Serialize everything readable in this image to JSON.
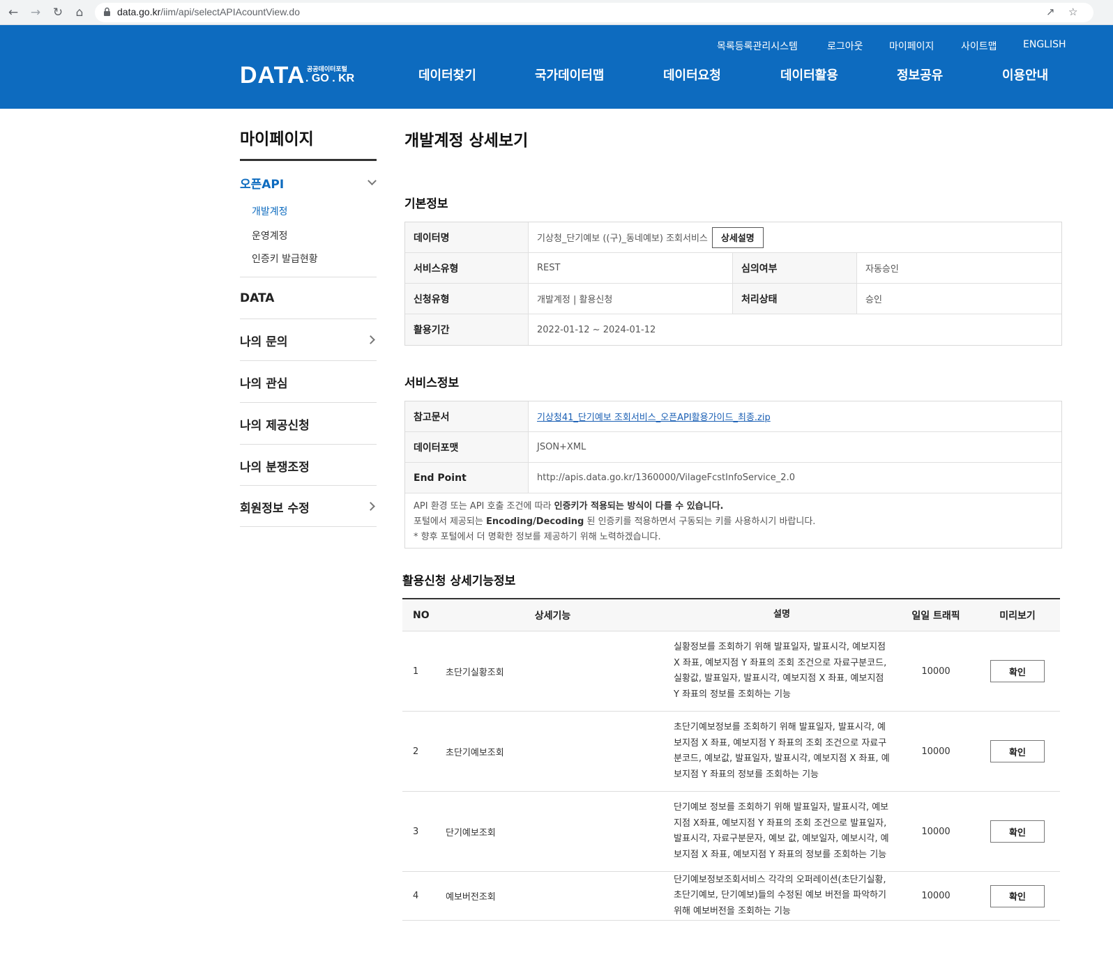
{
  "browser": {
    "url_host": "data.go.kr",
    "url_path": "/iim/api/selectAPIAcountView.do"
  },
  "header": {
    "utility_links": [
      "목록등록관리시스템",
      "로그아웃",
      "마이페이지",
      "사이트맵",
      "ENGLISH"
    ],
    "logo": {
      "main": "DATA",
      "sub": "공공데이터포털",
      "domain": ". GO . KR"
    },
    "gnb": [
      "데이터찾기",
      "국가데이터맵",
      "데이터요청",
      "데이터활용",
      "정보공유",
      "이용안내"
    ]
  },
  "sidebar": {
    "title": "마이페이지",
    "open_menu": "오픈API",
    "sub_items": [
      "개발계정",
      "운영계정",
      "인증키 발급현황"
    ],
    "items": [
      "DATA",
      "나의 문의",
      "나의 관심",
      "나의 제공신청",
      "나의 분쟁조정",
      "회원정보 수정"
    ]
  },
  "main": {
    "title": "개발계정 상세보기",
    "basic": {
      "section_title": "기본정보",
      "data_name_label": "데이터명",
      "data_name_value": "기상청_단기예보 ((구)_동네예보) 조회서비스",
      "detail_button": "상세설명",
      "service_type_label": "서비스유형",
      "service_type_value": "REST",
      "review_label": "심의여부",
      "review_value": "자동승인",
      "apply_type_label": "신청유형",
      "apply_type_value": "개발계정 | 활용신청",
      "status_label": "처리상태",
      "status_value": "승인",
      "period_label": "활용기간",
      "period_value": "2022-01-12 ~ 2024-01-12"
    },
    "service": {
      "section_title": "서비스정보",
      "ref_label": "참고문서",
      "ref_value": "기상청41_단기예보 조회서비스_오픈API활용가이드_최종.zip",
      "format_label": "데이터포맷",
      "format_value": "JSON+XML",
      "endpoint_label": "End Point",
      "endpoint_value": "http://apis.data.go.kr/1360000/VilageFcstInfoService_2.0",
      "notice_1a": "API 환경 또는 API 호출 조건에 따라 ",
      "notice_1b": "인증키가 적용되는 방식이 다를 수 있습니다.",
      "notice_2a": "포털에서 제공되는 ",
      "notice_2b": "Encoding/Decoding",
      "notice_2c": " 된 인증키를 적용하면서 구동되는 키를 사용하시기 바랍니다.",
      "notice_3": "* 향후 포털에서 더 명확한 정보를 제공하기 위해 노력하겠습니다."
    },
    "functions": {
      "section_title": "활용신청 상세기능정보",
      "headers": {
        "no": "NO",
        "name": "상세기능",
        "desc": "설명",
        "traffic": "일일 트래픽",
        "preview": "미리보기"
      },
      "rows": [
        {
          "no": "1",
          "name": "초단기실황조회",
          "desc": "실황정보를 조회하기 위해 발표일자, 발표시각, 예보지점 X 좌표, 예보지점 Y 좌표의 조회 조건으로 자료구분코드, 실황값, 발표일자, 발표시각, 예보지점 X 좌표, 예보지점 Y 좌표의 정보를 조회하는 기능",
          "traffic": "10000",
          "button": "확인"
        },
        {
          "no": "2",
          "name": "초단기예보조회",
          "desc": "초단기예보정보를 조회하기 위해 발표일자, 발표시각, 예보지점 X 좌표, 예보지점 Y 좌표의 조회 조건으로 자료구분코드, 예보값, 발표일자, 발표시각, 예보지점 X 좌표, 예보지점 Y 좌표의 정보를 조회하는 기능",
          "traffic": "10000",
          "button": "확인"
        },
        {
          "no": "3",
          "name": "단기예보조회",
          "desc": "단기예보 정보를 조회하기 위해 발표일자, 발표시각, 예보지점 X좌표, 예보지점 Y 좌표의 조회 조건으로 발표일자, 발표시각, 자료구분문자, 예보 값, 예보일자, 예보시각, 예보지점 X 좌표, 예보지점 Y 좌표의 정보를 조회하는 기능",
          "traffic": "10000",
          "button": "확인"
        },
        {
          "no": "4",
          "name": "예보버전조회",
          "desc": "단기예보정보조회서비스 각각의 오퍼레이션(초단기실황, 초단기예보, 단기예보)들의 수정된 예보 버전을 파악하기 위해 예보버전을 조회하는 기능",
          "traffic": "10000",
          "button": "확인"
        }
      ]
    }
  }
}
